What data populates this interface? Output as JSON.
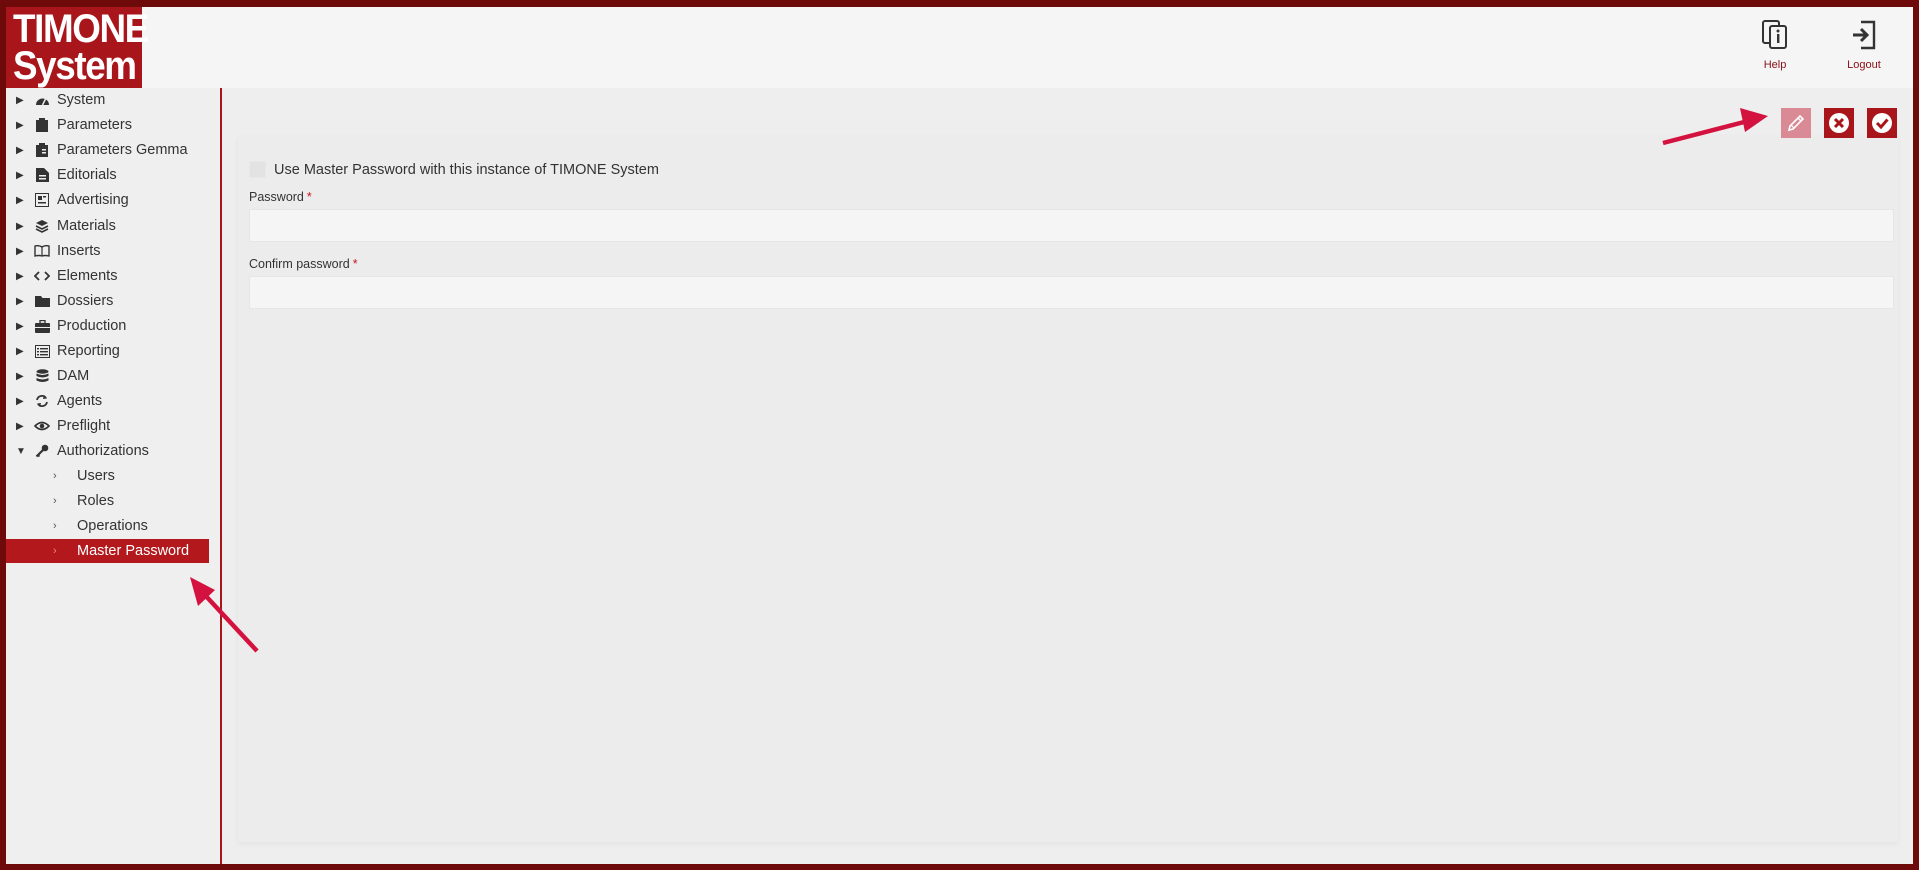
{
  "app": {
    "logo_line1": "TIMONE",
    "logo_line2": "System"
  },
  "header": {
    "help_label": "Help",
    "logout_label": "Logout"
  },
  "sidebar": {
    "items": [
      {
        "label": "System",
        "icon": "dashboard-icon"
      },
      {
        "label": "Parameters",
        "icon": "clipboard-icon"
      },
      {
        "label": "Parameters Gemma",
        "icon": "clipboard-list-icon"
      },
      {
        "label": "Editorials",
        "icon": "document-icon"
      },
      {
        "label": "Advertising",
        "icon": "newspaper-icon"
      },
      {
        "label": "Materials",
        "icon": "layers-icon"
      },
      {
        "label": "Inserts",
        "icon": "book-icon"
      },
      {
        "label": "Elements",
        "icon": "code-icon"
      },
      {
        "label": "Dossiers",
        "icon": "folder-icon"
      },
      {
        "label": "Production",
        "icon": "briefcase-icon"
      },
      {
        "label": "Reporting",
        "icon": "list-icon"
      },
      {
        "label": "DAM",
        "icon": "database-icon"
      },
      {
        "label": "Agents",
        "icon": "refresh-icon"
      },
      {
        "label": "Preflight",
        "icon": "eye-icon"
      },
      {
        "label": "Authorizations",
        "icon": "key-icon"
      }
    ],
    "sub_items": [
      {
        "label": "Users"
      },
      {
        "label": "Roles"
      },
      {
        "label": "Operations"
      },
      {
        "label": "Master Password"
      }
    ]
  },
  "form": {
    "use_master_label": "Use Master Password with this instance of TIMONE System",
    "password_label": "Password",
    "password_value": "",
    "confirm_label": "Confirm password",
    "confirm_value": "",
    "required_mark": "*"
  },
  "colors": {
    "brand": "#a8161b",
    "frame": "#6e0a0a",
    "active": "#b3181d",
    "annotation_arrow": "#d4123f"
  }
}
